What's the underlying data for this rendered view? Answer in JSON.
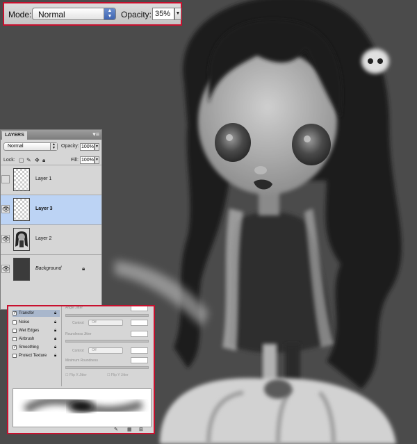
{
  "options_bar": {
    "mode_label": "Mode:",
    "mode_value": "Normal",
    "opacity_label": "Opacity:",
    "opacity_value": "35%"
  },
  "layers_panel": {
    "tab_title": "LAYERS",
    "blend_mode": "Normal",
    "opacity_label": "Opacity:",
    "opacity_value": "100%",
    "lock_label": "Lock:",
    "fill_label": "Fill:",
    "fill_value": "100%",
    "layers": [
      {
        "name": "Layer 1",
        "visible": false,
        "selected": false
      },
      {
        "name": "Layer 3",
        "visible": true,
        "selected": true
      },
      {
        "name": "Layer 2",
        "visible": true,
        "selected": false
      },
      {
        "name": "Background",
        "visible": true,
        "selected": false,
        "locked": true
      }
    ]
  },
  "brush_panel": {
    "options": [
      {
        "label": "Transfer",
        "checked": true,
        "selected": true
      },
      {
        "label": "Noise",
        "checked": false
      },
      {
        "label": "Wet Edges",
        "checked": false
      },
      {
        "label": "Airbrush",
        "checked": false
      },
      {
        "label": "Smoothing",
        "checked": true
      },
      {
        "label": "Protect Texture",
        "checked": false
      }
    ],
    "control_label": "Control:",
    "control_value": "Off",
    "roundness_jitter_label": "Roundness Jitter",
    "minimum_roundness_label": "Minimum Roundness",
    "flip_x_label": "Flip X Jitter",
    "flip_y_label": "Flip Y Jitter",
    "angle_jitter_label": "Angle Jitter"
  },
  "colors": {
    "highlight_border": "#c8102e",
    "layer_selected": "#bcd3f4",
    "panel_bg": "#d6d6d6"
  }
}
